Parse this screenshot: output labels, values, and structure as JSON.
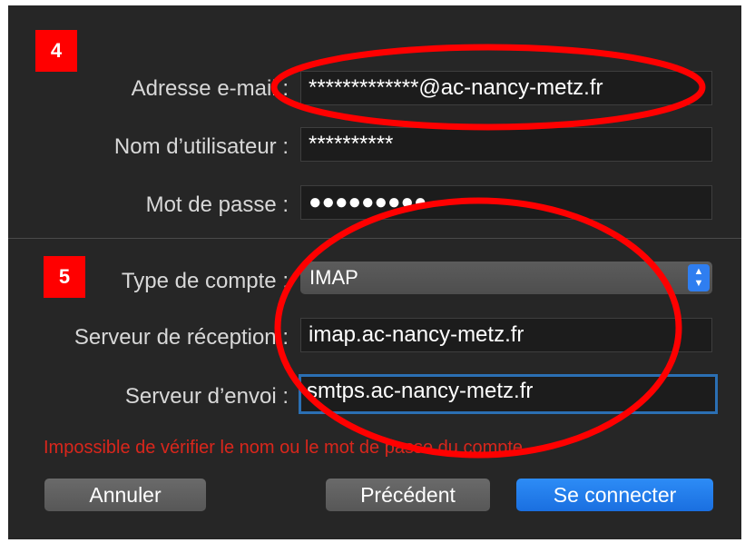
{
  "annotations": {
    "step4": "4",
    "step5": "5"
  },
  "account": {
    "email_label": "Adresse e-mail :",
    "email_value": "*************@ac-nancy-metz.fr",
    "username_label": "Nom d’utilisateur :",
    "username_value": "**********",
    "password_label": "Mot de passe :",
    "password_value": "●●●●●●●●●"
  },
  "server": {
    "type_label": "Type de compte :",
    "type_value": "IMAP",
    "incoming_label": "Serveur de réception :",
    "incoming_value": "imap.ac-nancy-metz.fr",
    "outgoing_label": "Serveur d’envoi :",
    "outgoing_value": "smtps.ac-nancy-metz.fr"
  },
  "error_message": "Impossible de vérifier le nom ou le mot de passe du compte.",
  "buttons": {
    "cancel": "Annuler",
    "previous": "Précédent",
    "connect": "Se connecter"
  },
  "colors": {
    "panel": "#262626",
    "annotation_red": "#ff0000",
    "accent_blue": "#1a6fe0",
    "error_red": "#d9261c"
  },
  "icons": {
    "select_stepper": "chevron-up-down-icon"
  }
}
